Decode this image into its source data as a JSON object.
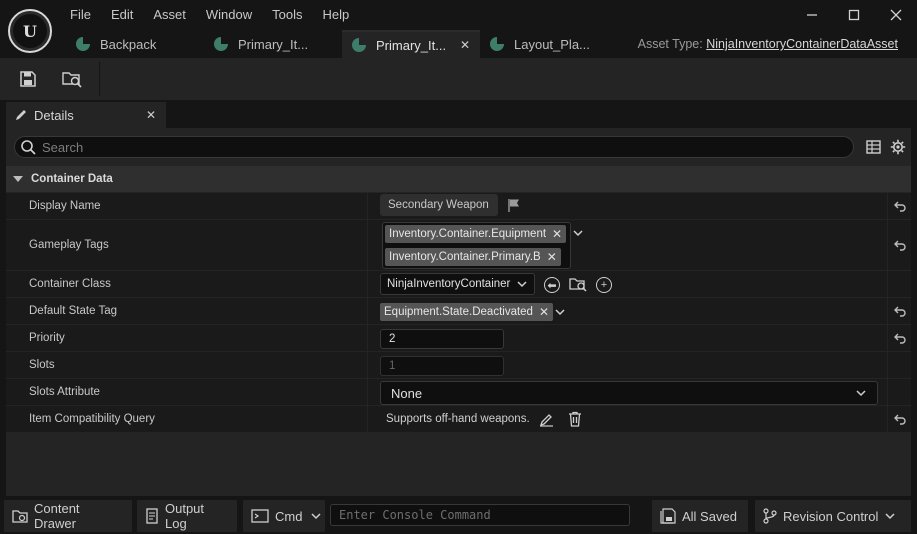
{
  "menu": [
    "File",
    "Edit",
    "Asset",
    "Window",
    "Tools",
    "Help"
  ],
  "window_controls": [
    "minimize-icon",
    "maximize-icon",
    "close-icon"
  ],
  "tabs": [
    {
      "label": "Backpack",
      "active": false
    },
    {
      "label": "Primary_It...",
      "active": false
    },
    {
      "label": "Primary_It...",
      "active": true
    },
    {
      "label": "Layout_Pla...",
      "active": false
    }
  ],
  "asset_type": {
    "label": "Asset Type:",
    "value": "NinjaInventoryContainerDataAsset"
  },
  "toolbar": {
    "save_icon": "save-icon",
    "browse_icon": "browse-to-asset-icon"
  },
  "details": {
    "tab_label": "Details",
    "search_placeholder": "Search",
    "category": "Container Data",
    "properties": {
      "display_name": {
        "label": "Display Name",
        "value": "Secondary Weapon"
      },
      "gameplay_tags": {
        "label": "Gameplay Tags",
        "tags": [
          "Inventory.Container.Equipment",
          "Inventory.Container.Primary.B"
        ]
      },
      "container_class": {
        "label": "Container Class",
        "value": "NinjaInventoryContainer"
      },
      "default_state_tag": {
        "label": "Default State Tag",
        "value": "Equipment.State.Deactivated"
      },
      "priority": {
        "label": "Priority",
        "value": "2"
      },
      "slots": {
        "label": "Slots",
        "value": "1"
      },
      "slots_attribute": {
        "label": "Slots Attribute",
        "value": "None"
      },
      "item_query": {
        "label": "Item Compatibility Query",
        "value": "Supports off-hand weapons."
      }
    }
  },
  "statusbar": {
    "content_drawer": "Content Drawer",
    "output_log": "Output Log",
    "cmd": "Cmd",
    "console_placeholder": "Enter Console Command",
    "all_saved": "All Saved",
    "revision_control": "Revision Control"
  },
  "colors": {
    "background": "#151515",
    "panel": "#242424",
    "row": "#1a1a1a",
    "accent_asset": "#3f7d6b"
  }
}
